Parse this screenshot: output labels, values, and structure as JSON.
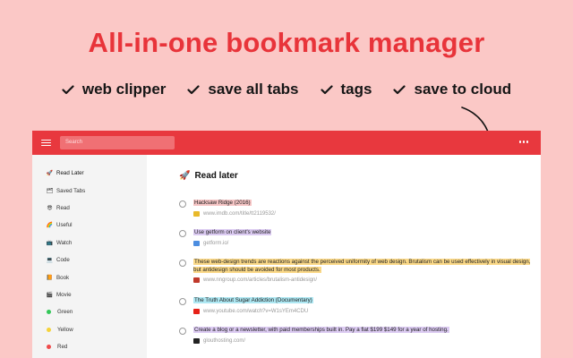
{
  "headline": "All-in-one bookmark manager",
  "features": [
    "web clipper",
    "save all tabs",
    "tags",
    "save to cloud"
  ],
  "app": {
    "search_placeholder": "Search",
    "sidebar": [
      {
        "label": "Read Later",
        "icon": "🚀",
        "type": "emoji"
      },
      {
        "label": "Saved Tabs",
        "icon": "🗂",
        "type": "emoji"
      },
      {
        "label": "Read",
        "icon": "😎",
        "type": "emoji"
      },
      {
        "label": "Useful",
        "icon": "🌈",
        "type": "emoji"
      },
      {
        "label": "Watch",
        "icon": "📺",
        "type": "emoji"
      },
      {
        "label": "Code",
        "icon": "💻",
        "type": "emoji"
      },
      {
        "label": "Book",
        "icon": "📙",
        "type": "emoji"
      },
      {
        "label": "Movie",
        "icon": "🎬",
        "type": "emoji"
      },
      {
        "label": "Green",
        "color": "#34c759",
        "type": "dot"
      },
      {
        "label": "Yellow",
        "color": "#f5d33a",
        "type": "dot"
      },
      {
        "label": "Red",
        "color": "#ef4b4b",
        "type": "dot"
      }
    ],
    "main_title": "Read later",
    "main_icon": "🚀",
    "bookmarks": [
      {
        "title": "Hacksaw Ridge (2016)",
        "url": "www.imdb.com/title/tt2119532/",
        "highlight": "red",
        "favicon_color": "#e8b92a"
      },
      {
        "title": "Use getform on client's website",
        "url": "getform.io/",
        "highlight": "purple",
        "favicon_color": "#4c8de0"
      },
      {
        "title": "These web-design trends are reactions against the perceived uniformity of web design. Brutalism can be used effectively in visual design, but antidesign should be avoided for most products.",
        "url": "www.nngroup.com/articles/brutalism-antidesign/",
        "highlight": "yellow",
        "favicon_color": "#c0392b"
      },
      {
        "title": "The Truth About Sugar Addiction (Documentary)",
        "url": "www.youtube.com/watch?v=W1sYEm4CDU",
        "highlight": "cyan",
        "favicon_color": "#e62117"
      },
      {
        "title": "Create a blog or a newsletter, with paid memberships built in. Pay a flat $199 $149 for a year of hosting.",
        "url": "glouthosting.com/",
        "highlight": "purple",
        "favicon_color": "#222222"
      }
    ]
  }
}
